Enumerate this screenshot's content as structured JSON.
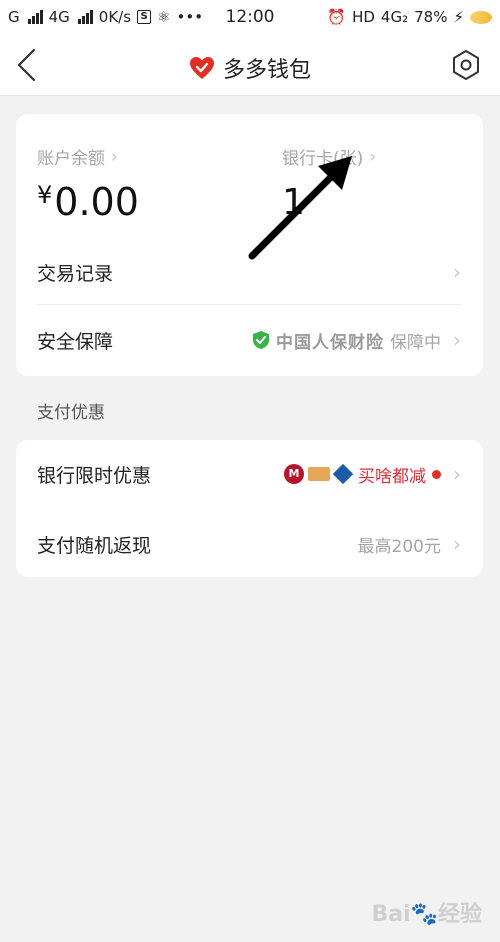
{
  "status_bar": {
    "carrier1": "G",
    "carrier2": "4G",
    "speed": "0K/s",
    "time": "12:00",
    "network": "HD",
    "net_type": "4G₂",
    "battery": "78%"
  },
  "header": {
    "title": "多多钱包"
  },
  "account": {
    "balance_label": "账户余额",
    "balance_currency": "¥",
    "balance_value": "0.00",
    "bankcard_label": "银行卡(张)",
    "bankcard_value": "1"
  },
  "rows": {
    "transactions": "交易记录",
    "security": "安全保障",
    "security_partner": "中国人保财险",
    "security_status": "保障中"
  },
  "promo": {
    "section_title": "支付优惠",
    "bank_offer": "银行限时优惠",
    "bank_offer_tag": "买啥都减",
    "cashback": "支付随机返现",
    "cashback_value": "最高200元"
  },
  "colors": {
    "accent_red": "#e02e24",
    "shield_green": "#3cb34a"
  }
}
